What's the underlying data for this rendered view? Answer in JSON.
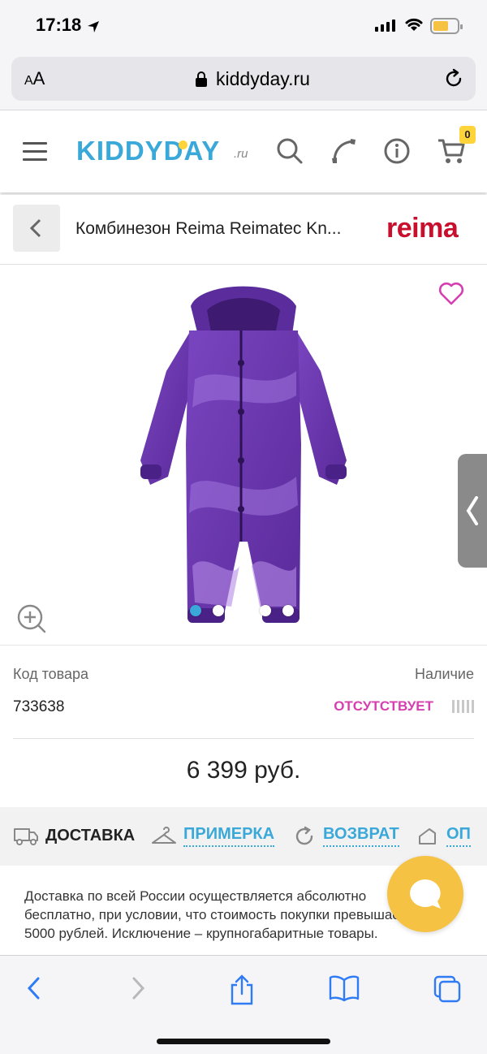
{
  "status": {
    "time": "17:18"
  },
  "browser": {
    "domain": "kiddyday.ru",
    "aa_small": "A",
    "aa_big": "A"
  },
  "site": {
    "logo": "KIDDYDAY",
    "logo_suffix": ".ru",
    "cart_count": "0"
  },
  "product": {
    "title": "Комбинезон Reima Reimatec Kn...",
    "brand": "reima",
    "sku_label": "Код товара",
    "sku": "733638",
    "availability_label": "Наличие",
    "availability": "ОТСУТСТВУЕТ",
    "price": "6 399 руб.",
    "gallery_images": 4,
    "gallery_active": 1
  },
  "tabs": [
    {
      "label": "ДОСТАВКА",
      "icon": "truck-icon",
      "active": true
    },
    {
      "label": "ПРИМЕРКА",
      "icon": "hanger-icon",
      "active": false
    },
    {
      "label": "ВОЗВРАТ",
      "icon": "return-icon",
      "active": false
    },
    {
      "label": "ОП",
      "icon": "wallet-icon",
      "active": false
    }
  ],
  "delivery_text": "Доставка по всей России осуществляется абсолютно бесплатно, при условии, что стоимость покупки превышает 5000 рублей. Исключение – крупногабаритные товары.",
  "colors": {
    "accent": "#3aa9d9",
    "brand_red": "#c8102e",
    "out_of_stock": "#d63fb0",
    "chat": "#f5c243",
    "ios_blue": "#2f7bf5"
  }
}
